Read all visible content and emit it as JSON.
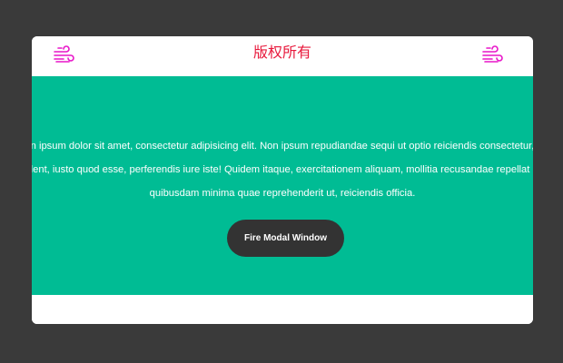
{
  "header": {
    "title": "版权所有",
    "left_icon": "wind-icon",
    "right_icon": "wind-icon",
    "icon_color": "#e815c9"
  },
  "hero": {
    "background": "#00bc94",
    "text_lines": [
      "n ipsum dolor sit amet, consectetur adipisicing elit. Non ipsum repudiandae sequi ut optio reiciendis consectetur,",
      "dent, iusto quod esse, perferendis iure iste! Quidem itaque, exercitationem aliquam, mollitia recusandae repellat c",
      "quibusdam minima quae reprehenderit ut, reiciendis officia."
    ],
    "button_label": "Fire Modal Window"
  }
}
